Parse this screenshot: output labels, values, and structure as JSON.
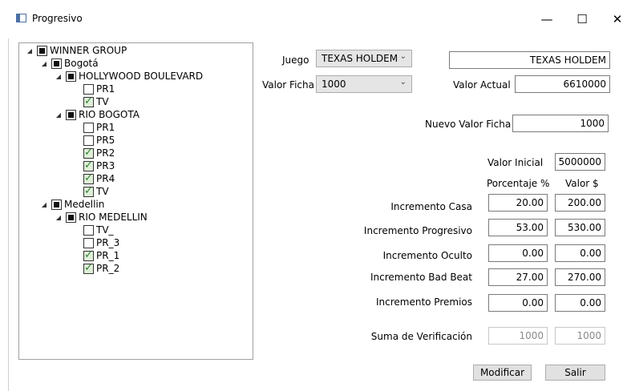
{
  "window": {
    "title": "Progresivo",
    "minimize_glyph": "—",
    "maximize_glyph": "☐",
    "close_glyph": "✕"
  },
  "tree": {
    "items": [
      {
        "label": "WINNER GROUP",
        "state": "partial",
        "expanded": true,
        "level": 0
      },
      {
        "label": "Bogotá",
        "state": "partial",
        "expanded": true,
        "level": 1
      },
      {
        "label": "HOLLYWOOD BOULEVARD",
        "state": "partial",
        "expanded": true,
        "level": 2
      },
      {
        "label": "PR1",
        "state": "unchecked",
        "level": 3
      },
      {
        "label": "TV",
        "state": "checked",
        "level": 3
      },
      {
        "label": "RIO BOGOTA",
        "state": "partial",
        "expanded": true,
        "level": 2
      },
      {
        "label": "PR1",
        "state": "unchecked",
        "level": 3
      },
      {
        "label": "PR5",
        "state": "unchecked",
        "level": 3
      },
      {
        "label": "PR2",
        "state": "checked",
        "level": 3
      },
      {
        "label": "PR3",
        "state": "checked",
        "level": 3
      },
      {
        "label": "PR4",
        "state": "checked",
        "level": 3
      },
      {
        "label": "TV",
        "state": "checked",
        "level": 3
      },
      {
        "label": "Medellin",
        "state": "partial",
        "expanded": true,
        "level": 1
      },
      {
        "label": "RIO MEDELLIN",
        "state": "partial",
        "expanded": true,
        "level": 2
      },
      {
        "label": "TV_",
        "state": "unchecked",
        "level": 3
      },
      {
        "label": "PR_3",
        "state": "unchecked",
        "level": 3
      },
      {
        "label": "PR_1",
        "state": "checked",
        "level": 3
      },
      {
        "label": "PR_2",
        "state": "checked",
        "level": 3
      }
    ]
  },
  "form": {
    "juego_label": "Juego",
    "juego_value": "TEXAS HOLDEM",
    "juego_display": "TEXAS HOLDEM",
    "valor_ficha_label": "Valor Ficha",
    "valor_ficha_value": "1000",
    "valor_actual_label": "Valor Actual",
    "valor_actual_value": "6610000",
    "nuevo_valor_label": "Nuevo Valor Ficha",
    "nuevo_valor_value": "1000",
    "valor_inicial_label": "Valor Inicial",
    "valor_inicial_value": "5000000",
    "col_porcentaje": "Porcentaje %",
    "col_valor": "Valor $",
    "rows": [
      {
        "label": "Incremento Casa",
        "pct": "20.00",
        "val": "200.00"
      },
      {
        "label": "Incremento Progresivo",
        "pct": "53.00",
        "val": "530.00"
      },
      {
        "label": "Incremento Oculto",
        "pct": "0.00",
        "val": "0.00"
      },
      {
        "label": "Incremento Bad Beat",
        "pct": "27.00",
        "val": "270.00"
      },
      {
        "label": "Incremento Premios",
        "pct": "0.00",
        "val": "0.00"
      }
    ],
    "suma_label": "Suma de Verificación",
    "suma_pct": "1000",
    "suma_val": "1000"
  },
  "buttons": {
    "modificar": "Modificar",
    "salir": "Salir"
  },
  "icons": {
    "expanded_arrow": "◢"
  }
}
